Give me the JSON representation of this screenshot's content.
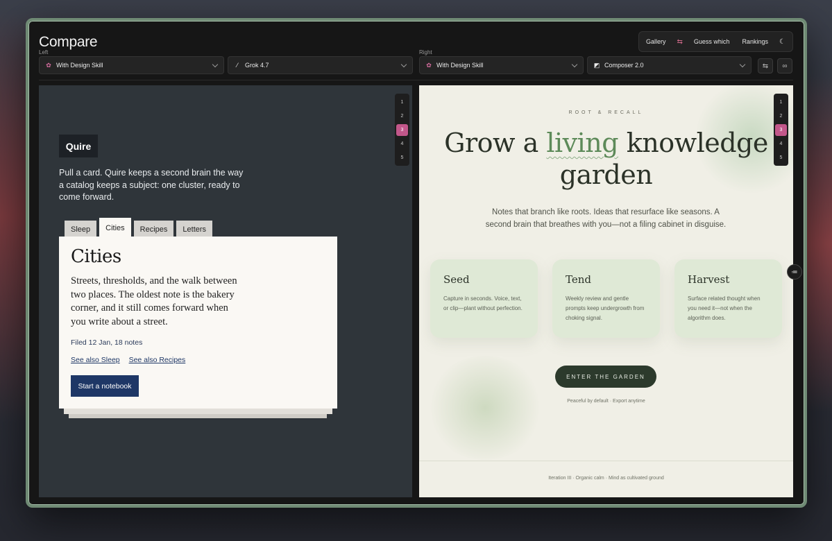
{
  "app": {
    "title": "Compare",
    "left_label": "Left",
    "right_label": "Right",
    "nav": {
      "gallery": "Gallery",
      "swap_icon": "⇆",
      "guess": "Guess which",
      "rankings": "Rankings",
      "theme_icon": "☾"
    },
    "left_selects": [
      {
        "label": "With Design Skill",
        "icon": "✿"
      },
      {
        "label": "Grok 4.7",
        "icon": "⁄"
      }
    ],
    "right_selects": [
      {
        "label": "With Design Skill",
        "icon": "✿"
      },
      {
        "label": "Composer 2.0",
        "icon": "◩"
      }
    ],
    "swap_btn_icon": "⇆",
    "link_btn_icon": "∞",
    "float_btn_icon": "≔",
    "accent_color": "#c2578a"
  },
  "pager": [
    "1",
    "2",
    "3",
    "4",
    "5"
  ],
  "pager_active": 3,
  "left": {
    "logo": "Quire",
    "intro": "Pull a card. Quire keeps a second brain the way a catalog keeps a subject: one cluster, ready to come forward.",
    "tabs": [
      "Sleep",
      "Cities",
      "Recipes",
      "Letters"
    ],
    "active_tab": "Cities",
    "card": {
      "title": "Cities",
      "description": "Streets, thresholds, and the walk between two places. The oldest note is the bakery corner, and it still comes forward when you write about a street.",
      "filed": "Filed 12 Jan, 18 notes",
      "links": [
        "See also Sleep",
        "See also Recipes"
      ],
      "cta": "Start a notebook"
    }
  },
  "right": {
    "eyebrow": "ROOT & RECALL",
    "hero_pre": "Grow a ",
    "hero_accent": "living",
    "hero_post": " knowledge garden",
    "sub": "Notes that branch like roots. Ideas that resurface like seasons. A second brain that breathes with you—not a filing cabinet in disguise.",
    "features": [
      {
        "title": "Seed",
        "text": "Capture in seconds. Voice, text, or clip—plant without perfection."
      },
      {
        "title": "Tend",
        "text": "Weekly review and gentle prompts keep undergrowth from choking signal."
      },
      {
        "title": "Harvest",
        "text": "Surface related thought when you need it—not when the algorithm does."
      }
    ],
    "cta": "ENTER THE GARDEN",
    "note": "Peaceful by default · Export anytime",
    "footer": "Iteration III · Organic calm · Mind as cultivated ground"
  }
}
